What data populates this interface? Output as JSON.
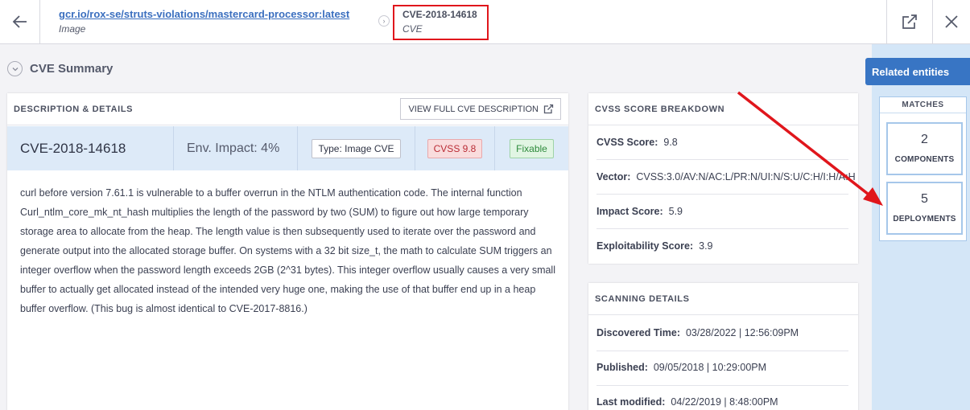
{
  "header": {
    "image_link": "gcr.io/rox-se/struts-violations/mastercard-processor:latest",
    "image_label": "Image",
    "cve_title": "CVE-2018-14618",
    "cve_label": "CVE"
  },
  "summary": {
    "title": "CVE Summary"
  },
  "description_panel": {
    "heading": "DESCRIPTION & DETAILS",
    "view_button": "VIEW FULL CVE DESCRIPTION",
    "cve_id": "CVE-2018-14618",
    "env_impact": "Env. Impact: 4%",
    "type_badge": "Type: Image CVE",
    "cvss_badge": "CVSS 9.8",
    "fixable_badge": "Fixable",
    "description": "curl before version 7.61.1 is vulnerable to a buffer overrun in the NTLM authentication code. The internal function Curl_ntlm_core_mk_nt_hash multiplies the length of the password by two (SUM) to figure out how large temporary storage area to allocate from the heap. The length value is then subsequently used to iterate over the password and generate output into the allocated storage buffer. On systems with a 32 bit size_t, the math to calculate SUM triggers an integer overflow when the password length exceeds 2GB (2^31 bytes). This integer overflow usually causes a very small buffer to actually get allocated instead of the intended very huge one, making the use of that buffer end up in a heap buffer overflow. (This bug is almost identical to CVE-2017-8816.)"
  },
  "cvss_panel": {
    "heading": "CVSS SCORE BREAKDOWN",
    "cvss_label": "CVSS Score:",
    "cvss_value": "9.8",
    "vector_label": "Vector:",
    "vector_value": "CVSS:3.0/AV:N/AC:L/PR:N/UI:N/S:U/C:H/I:H/A:H",
    "impact_label": "Impact Score:",
    "impact_value": "5.9",
    "exploit_label": "Exploitability Score:",
    "exploit_value": "3.9"
  },
  "scan_panel": {
    "heading": "SCANNING DETAILS",
    "discovered_label": "Discovered Time:",
    "discovered_value": "03/28/2022 | 12:56:09PM",
    "published_label": "Published:",
    "published_value": "09/05/2018 | 10:29:00PM",
    "modified_label": "Last modified:",
    "modified_value": "04/22/2019 | 8:48:00PM"
  },
  "sidebar": {
    "related_button": "Related entities",
    "matches_heading": "MATCHES",
    "components_count": "2",
    "components_label": "COMPONENTS",
    "deployments_count": "5",
    "deployments_label": "DEPLOYMENTS"
  },
  "colors": {
    "accent": "#3875c4",
    "highlight": "#e0161c",
    "sidebar_bg": "#d4e6f7",
    "cve_row_bg": "#ddeaf8"
  },
  "icons": [
    "arrow-left-icon",
    "chevron-right-icon",
    "external-link-icon",
    "close-icon",
    "chevron-down-icon"
  ]
}
